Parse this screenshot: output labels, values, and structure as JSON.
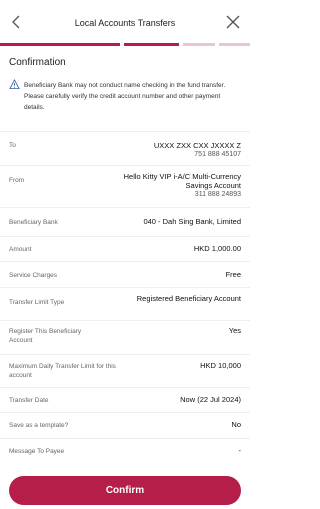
{
  "header": {
    "title": "Local Accounts Transfers",
    "back_icon": "chevron-left-icon",
    "close_icon": "close-icon"
  },
  "progress": {
    "steps": 4,
    "current": 2,
    "active_color": "#b51e48",
    "inactive_color": "#e6c6d0"
  },
  "section": {
    "title": "Confirmation"
  },
  "notice": {
    "icon": "warning-icon",
    "text": "Beneficiary Bank may not conduct name checking in the fund transfer. Please carefully verify the credit account number and other payment details."
  },
  "rows": [
    {
      "label": "To",
      "value": "UXXX ZXX CXX JXXXX Z",
      "sub": "751 888 45107"
    },
    {
      "label": "From",
      "value": "Hello Kitty VIP i-A/C Multi-Currency Savings Account",
      "sub": "311 888 24893"
    },
    {
      "label": "Beneficiary Bank",
      "value": "040 - Dah Sing Bank, Limited"
    },
    {
      "label": "Amount",
      "value": "HKD 1,000.00"
    },
    {
      "label": "Service Charges",
      "value": "Free"
    },
    {
      "label": "Transfer Limit Type",
      "value": "Registered Beneficiary Account"
    },
    {
      "label": "Register This Beneficiary Account",
      "value": "Yes"
    },
    {
      "label": "Maximum Daily Transfer Limit for this account",
      "value": "HKD  10,000"
    },
    {
      "label": "Transfer Date",
      "value": "Now (22 Jul 2024)"
    },
    {
      "label": "Save as a template?",
      "value": "No"
    },
    {
      "label": "Message To Payee",
      "value": "-"
    }
  ],
  "confirm_button": {
    "label": "Confirm",
    "color": "#b51e48"
  }
}
